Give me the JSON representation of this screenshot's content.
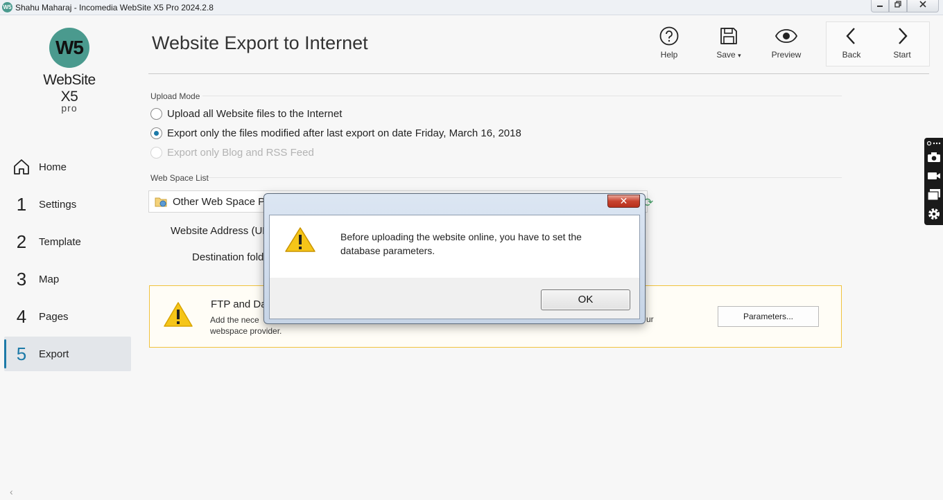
{
  "window": {
    "title": "Shahu Maharaj - Incomedia WebSite X5 Pro 2024.2.8",
    "icon_text": "W5",
    "controls": [
      "minimize",
      "restore",
      "close"
    ]
  },
  "logo": {
    "mark": "W5",
    "name": "WebSite X5",
    "edition": "pro"
  },
  "sidebar": {
    "items": [
      {
        "num": "",
        "label": "Home",
        "icon": "home-icon"
      },
      {
        "num": "1",
        "label": "Settings"
      },
      {
        "num": "2",
        "label": "Template"
      },
      {
        "num": "3",
        "label": "Map"
      },
      {
        "num": "4",
        "label": "Pages"
      },
      {
        "num": "5",
        "label": "Export",
        "active": true
      }
    ],
    "collapse_glyph": "‹"
  },
  "header": {
    "title": "Website Export to Internet",
    "tools": {
      "help": "Help",
      "save": "Save",
      "save_dropdown": "▾",
      "preview": "Preview",
      "back": "Back",
      "start": "Start"
    }
  },
  "upload_mode": {
    "label": "Upload Mode",
    "options": [
      {
        "label": "Upload all Website files to the Internet",
        "checked": false,
        "disabled": false
      },
      {
        "label": "Export only the files modified after last export on date Friday, March 16, 2018",
        "checked": true,
        "disabled": false
      },
      {
        "label": "Export only Blog and RSS Feed",
        "checked": false,
        "disabled": true
      }
    ]
  },
  "web_space": {
    "label": "Web Space List",
    "selected_provider": "Other Web Space Pr",
    "refresh_glyph": "⟳",
    "website_address_label": "Website Address (UR",
    "destination_label": "Destination fold"
  },
  "ftp_box": {
    "title": "FTP and Da",
    "text_start": "Add the nece",
    "text_line2": "webspace provider.",
    "text_end": "ur",
    "button": "Parameters..."
  },
  "dialog": {
    "message": "Before uploading the website online, you have to set the database parameters.",
    "ok": "OK",
    "close_glyph": "✕"
  },
  "colors": {
    "accent": "#1d7aa8",
    "logo": "#4a9a8e",
    "warning_border": "#f0c23c",
    "warning_icon": "#f5c518"
  }
}
